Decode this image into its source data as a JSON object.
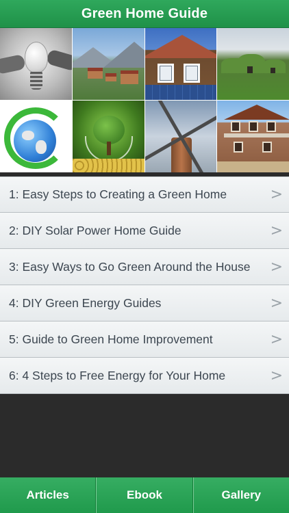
{
  "header": {
    "title": "Green Home Guide"
  },
  "gallery": [
    {
      "name": "tile-light-bulb"
    },
    {
      "name": "tile-mountain-village"
    },
    {
      "name": "tile-wooden-house"
    },
    {
      "name": "tile-turf-houses"
    },
    {
      "name": "tile-recycle-globe"
    },
    {
      "name": "tile-tree-in-glass"
    },
    {
      "name": "tile-windmill"
    },
    {
      "name": "tile-western-house"
    }
  ],
  "list": {
    "chevron": ">",
    "items": [
      {
        "label": "1: Easy Steps to Creating a Green Home"
      },
      {
        "label": "2: DIY Solar Power Home Guide"
      },
      {
        "label": "3: Easy Ways to Go Green Around the House"
      },
      {
        "label": "4: DIY Green Energy Guides"
      },
      {
        "label": "5: Guide to Green Home Improvement"
      },
      {
        "label": "6: 4 Steps to Free Energy for Your Home"
      }
    ]
  },
  "tabs": [
    {
      "label": "Articles"
    },
    {
      "label": "Ebook"
    },
    {
      "label": "Gallery"
    }
  ],
  "colors": {
    "accent": "#209a4c",
    "background": "#2b2b2b",
    "list_text": "#3c4650"
  }
}
